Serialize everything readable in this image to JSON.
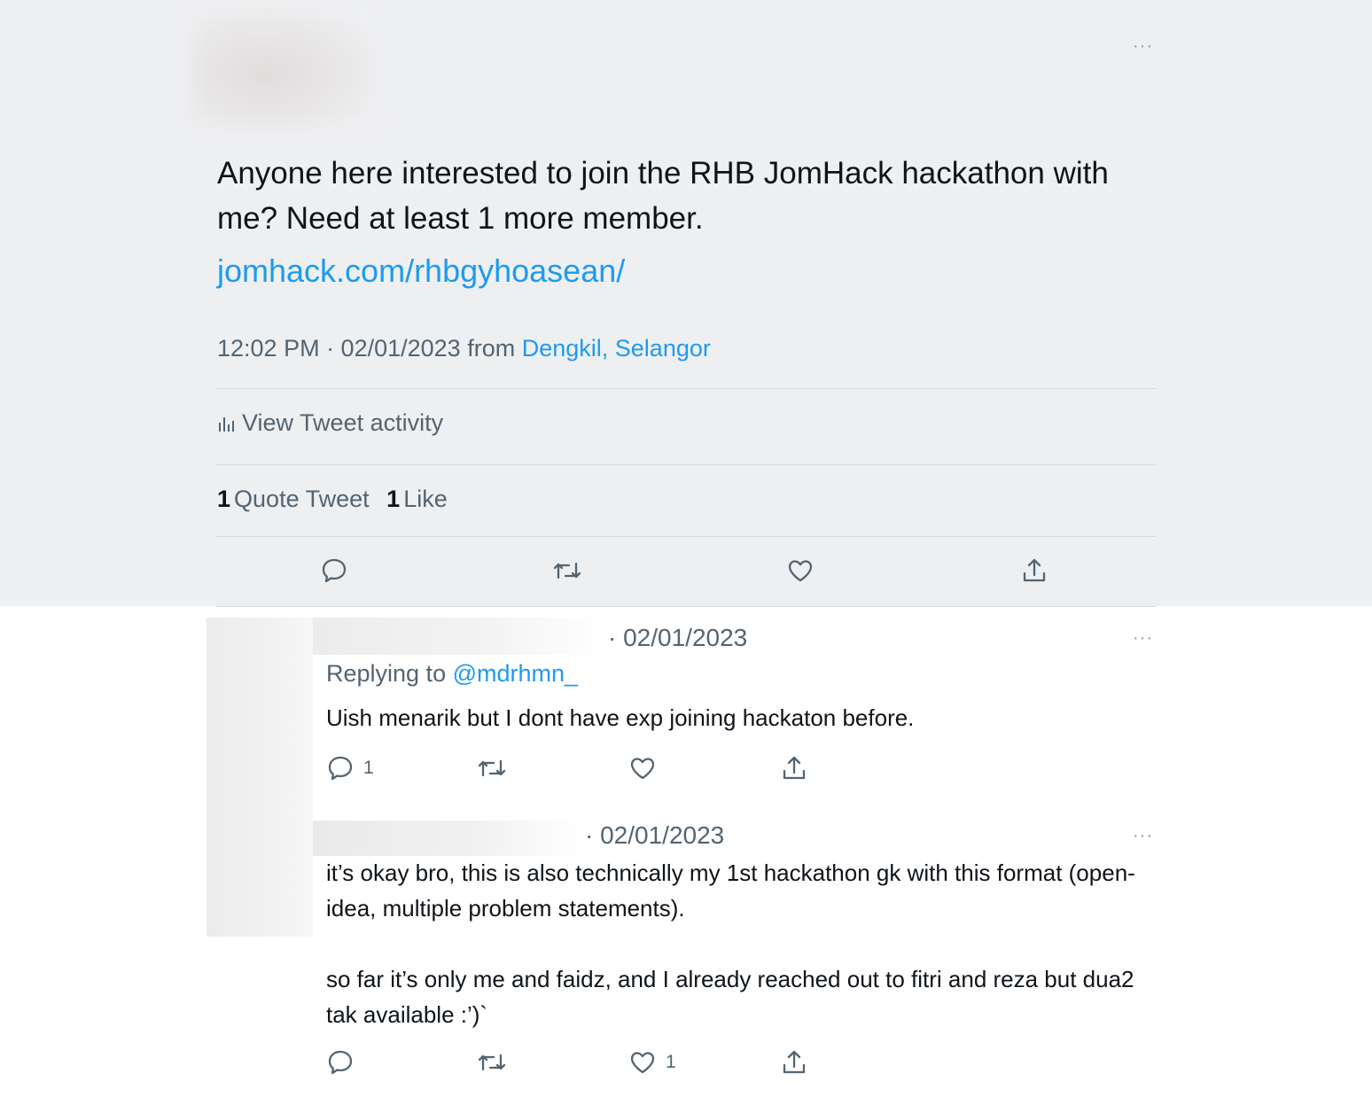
{
  "main_tweet": {
    "text": "Anyone here interested to join the RHB JomHack hackathon with me? Need at least 1 more member.",
    "link": "jomhack.com/rhbgyhoasean/",
    "time": "12:02 PM · 02/01/2023",
    "from_label": "from",
    "location": "Dengkil, Selangor",
    "activity_label": "View Tweet activity",
    "quote_count": "1",
    "quote_label": "Quote Tweet",
    "like_count": "1",
    "like_label": "Like",
    "more_label": "···"
  },
  "replies": [
    {
      "date": "· 02/01/2023",
      "replying_prefix": "Replying to",
      "replying_handle": "@mdrhmn_",
      "text": "Uish menarik but I dont have exp joining hackaton before.",
      "reply_count": "1",
      "like_count": ""
    },
    {
      "date": "· 02/01/2023",
      "text": "it’s okay bro, this is also technically my 1st hackathon gk with this format (open-idea, multiple problem statements).\n\nso far it’s only me and faidz, and I already reached out to fitri and reza but dua2 tak available :’)`",
      "reply_count": "",
      "like_count": "1"
    }
  ],
  "icons": [
    "more-icon",
    "analytics-icon",
    "reply-icon",
    "retweet-icon",
    "like-icon",
    "share-icon"
  ],
  "colors": {
    "accent": "#1d9bf0",
    "secondary_text": "#536471",
    "top_background": "#eeeff1"
  }
}
